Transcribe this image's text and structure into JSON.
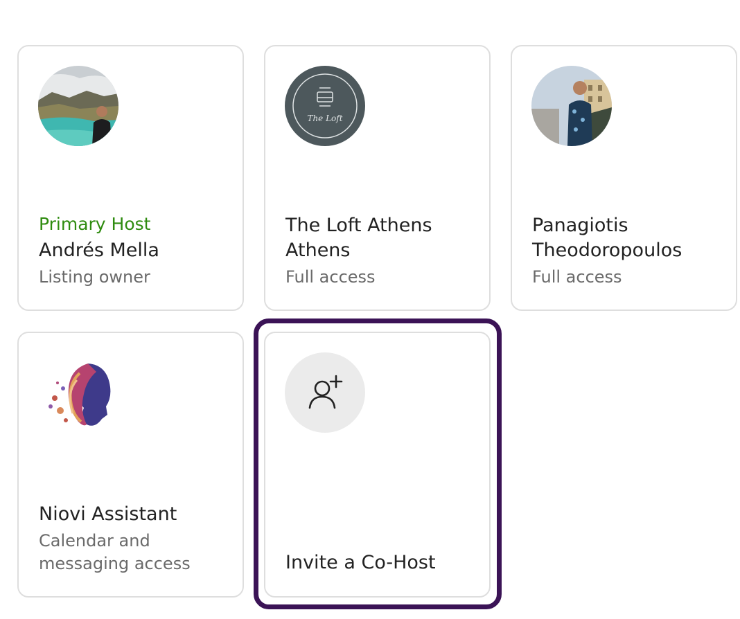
{
  "cohosts": [
    {
      "role": "Primary Host",
      "name": "Andrés Mella",
      "access": "Listing owner",
      "avatar": "person-mountain-lake-photo"
    },
    {
      "name": "The Loft Athens Athens",
      "access": "Full access",
      "avatar": "the-loft-logo",
      "logo_text": "The Loft"
    },
    {
      "name": "Panagiotis Theodoropoulos",
      "access": "Full access",
      "avatar": "person-city-photo"
    },
    {
      "name": "Niovi Assistant",
      "access": "Calendar and messaging access",
      "avatar": "ai-woman-profile-illustration"
    }
  ],
  "invite": {
    "label": "Invite a Co-Host",
    "icon": "add-person-icon"
  },
  "colors": {
    "role_accent": "#2e8b0f",
    "focus_ring": "#3b1356",
    "card_border": "#dedede",
    "logo_bg": "#4d585c"
  }
}
